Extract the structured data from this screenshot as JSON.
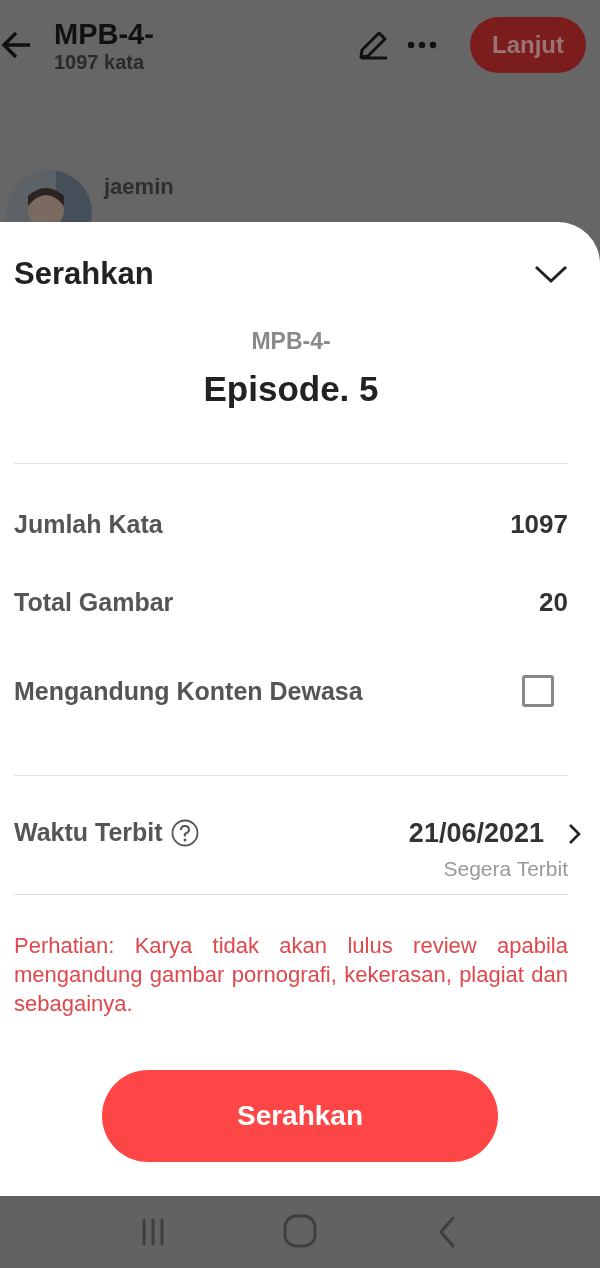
{
  "header": {
    "title": "MPB-4-",
    "word_count": "1097 kata",
    "next_button": "Lanjut"
  },
  "author": {
    "name": "jaemin"
  },
  "sheet": {
    "title": "Serahkan",
    "work_title": "MPB-4-",
    "episode": "Episode. 5",
    "stats": [
      {
        "label": "Jumlah Kata",
        "value": "1097"
      },
      {
        "label": "Total Gambar",
        "value": "20"
      }
    ],
    "adult_content": {
      "label": "Mengandung Konten Dewasa",
      "checked": false
    },
    "publish": {
      "label": "Waktu Terbit",
      "date": "21/06/2021",
      "note": "Segera Terbit"
    },
    "warning": "Perhatian: Karya tidak akan lulus review apabila mengandung gambar pornografi, kekerasan, plagiat dan sebagainya.",
    "submit_button": "Serahkan"
  }
}
